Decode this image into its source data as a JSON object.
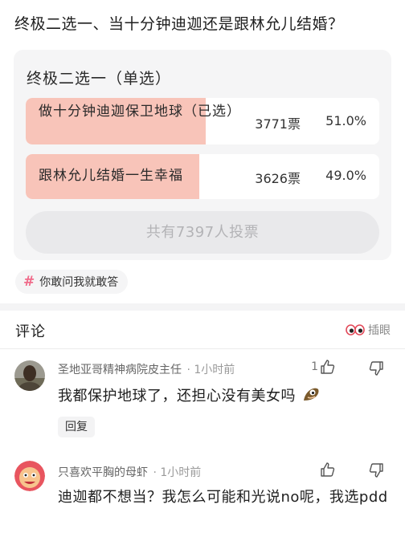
{
  "post": {
    "title": "终极二选一、当十分钟迪迦还是跟林允儿结婚？"
  },
  "poll": {
    "heading": "终极二选一（单选）",
    "options": [
      {
        "label": "做十分钟迪迦保卫地球（已选）",
        "votes": "3771票",
        "percent": "51.0%",
        "fraction": 0.51,
        "selected": true,
        "fill_color": "#f8c4b9"
      },
      {
        "label": "跟林允儿结婚一生幸福",
        "votes": "3626票",
        "percent": "49.0%",
        "fraction": 0.49,
        "selected": false,
        "fill_color": "#f8c4b9"
      }
    ],
    "total_label": "共有7397人投票"
  },
  "tag": {
    "label": "你敢问我就敢答",
    "icon": "hashtag-icon",
    "color": "#f06b8a"
  },
  "comments_section": {
    "title": "评论",
    "insert_eye_label": "插眼",
    "insert_eye_icon": "eyes-icon"
  },
  "comments": [
    {
      "author": "圣地亚哥精神病院皮主任",
      "time": "· 1小时前",
      "likes": "1",
      "text": "我都保护地球了，还担心没有美女吗",
      "emoji_icon": "smirk-emoji-icon",
      "reply_label": "回复"
    },
    {
      "author": "只喜欢平胸的母虾",
      "time": "· 1小时前",
      "likes": "",
      "text": "迪迦都不想当？我怎么可能和光说no呢，我选pdd"
    }
  ],
  "colors": {
    "accent_pink": "#f06b8a",
    "poll_fill": "#f8c4b9",
    "card_bg": "#f5f5f6"
  }
}
